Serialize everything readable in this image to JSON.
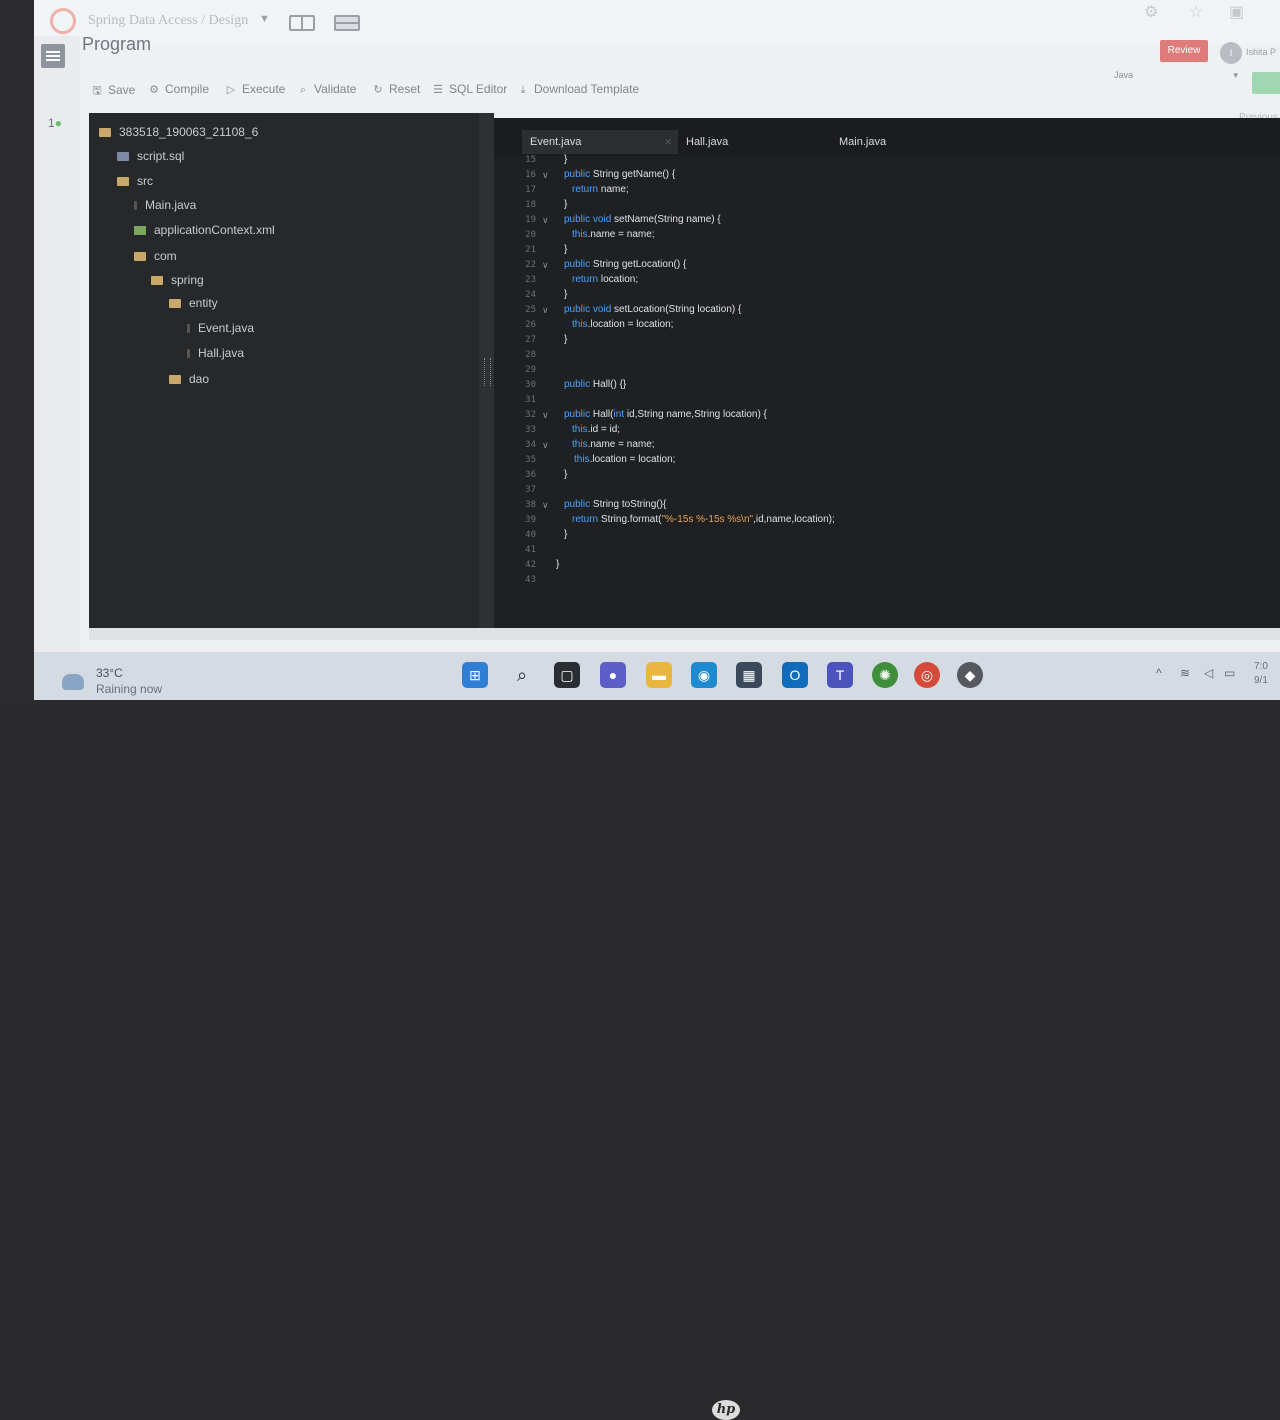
{
  "app": {
    "title": "Spring Data Access / Design",
    "page_title": "Program",
    "review_label": "Review",
    "user_initial": "I",
    "user_name": "Ishita P",
    "language": "Java",
    "previous_label": "Previous"
  },
  "toolbar": {
    "save": "Save",
    "compile": "Compile",
    "execute": "Execute",
    "validate": "Validate",
    "reset": "Reset",
    "sql_editor": "SQL Editor",
    "download_template": "Download Template"
  },
  "tree": {
    "root": "383518_190063_21108_6",
    "script": "script.sql",
    "src": "src",
    "main": "Main.java",
    "context": "applicationContext.xml",
    "com": "com",
    "spring": "spring",
    "entity": "entity",
    "event": "Event.java",
    "hall": "Hall.java",
    "dao": "dao"
  },
  "tabs": [
    "Event.java",
    "Hall.java",
    "Main.java"
  ],
  "code": {
    "line_numbers": [
      "15",
      "16",
      "17",
      "18",
      "19",
      "20",
      "21",
      "22",
      "23",
      "24",
      "25",
      "26",
      "27",
      "28",
      "29",
      "30",
      "31",
      "32",
      "33",
      "34",
      "35",
      "36",
      "37",
      "38",
      "39",
      "40",
      "41",
      "42",
      "43"
    ],
    "l15": "}",
    "l16_kw": "public",
    "l16_rest": " String getName() {",
    "l17_kw": "return",
    "l17_rest": " name;",
    "l18": "}",
    "l19_kw": "public void",
    "l19_rest": " setName(String name) {",
    "l20_kw": "this",
    "l20_rest": ".name = name;",
    "l21": "}",
    "l22_kw": "public",
    "l22_rest": " String getLocation() {",
    "l23_kw": "return",
    "l23_rest": " location;",
    "l24": "}",
    "l25_kw": "public void",
    "l25_rest": " setLocation(String location) {",
    "l26_kw": "this",
    "l26_rest": ".location = location;",
    "l27": "}",
    "l30_kw": "public",
    "l30_rest": " Hall() {}",
    "l32_kw": "public",
    "l32_a": " Hall(",
    "l32_kw2": "int",
    "l32_rest": " id,String name,String location) {",
    "l33_kw": "this",
    "l33_rest": ".id = id;",
    "l34_kw": "this",
    "l34_rest": ".name = name;",
    "l35_kw": "this",
    "l35_rest": ".location = location;",
    "l36": "}",
    "l38_kw": "public",
    "l38_rest": " String toString(){",
    "l39_kw": "return",
    "l39_a": " String.format(",
    "l39_str": "\"%-15s %-15s %s\\n\"",
    "l39_rest": ",id,name,location);",
    "l40": "}",
    "l42": "}"
  },
  "taskbar": {
    "temp": "33°C",
    "weather": "Raining now",
    "time": "7:0",
    "date": "9/1"
  },
  "colors": {
    "keyword": "#4aa3ff",
    "string": "#e8a35a",
    "editor_bg": "#1f2021"
  }
}
